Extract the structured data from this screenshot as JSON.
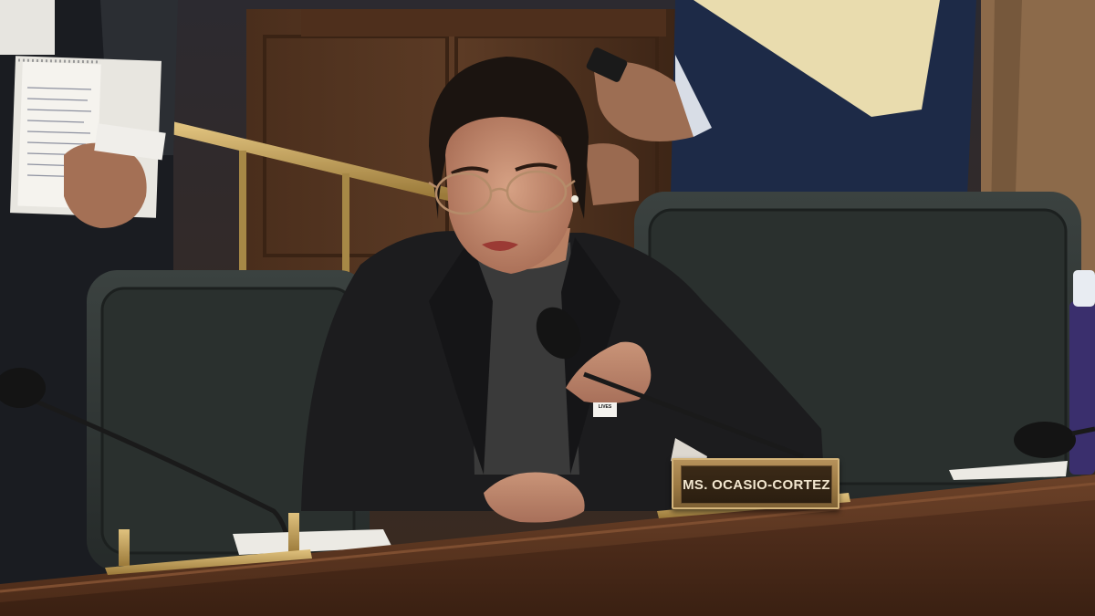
{
  "scene": {
    "nameplate_label": "MS. OCASIO-CORTEZ",
    "pin_label": "LIVES"
  },
  "colors": {
    "wood_dark": "#3a2415",
    "wood_mid": "#5a3a24",
    "chair_leather": "#2e3331",
    "blazer": "#1c1c1e",
    "turtleneck": "#3a3a3a",
    "brass": "#b89a55",
    "suit_navy": "#1d2a47",
    "coat_tan": "#8c6a4a"
  },
  "icons": [
    "microphone-left",
    "microphone-center",
    "microphone-right"
  ]
}
